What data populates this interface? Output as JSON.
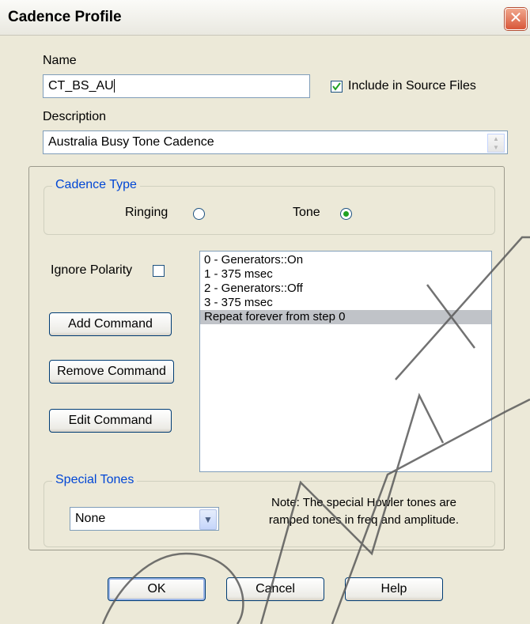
{
  "window": {
    "title": "Cadence Profile",
    "close_glyph": "✕"
  },
  "name": {
    "label": "Name",
    "value": "CT_BS_AU"
  },
  "include_source": {
    "label": "Include in Source Files",
    "checked": true
  },
  "description": {
    "label": "Description",
    "value": "Australia Busy Tone Cadence"
  },
  "cadence_type": {
    "title": "Cadence Type",
    "ringing_label": "Ringing",
    "tone_label": "Tone",
    "selected": "Tone"
  },
  "ignore_polarity": {
    "label": "Ignore Polarity",
    "checked": false
  },
  "buttons": {
    "add": "Add Command",
    "remove": "Remove Command",
    "edit": "Edit Command",
    "ok": "OK",
    "cancel": "Cancel",
    "help": "Help"
  },
  "commands": [
    "0 - Generators::On",
    "1 - 375 msec",
    "2 - Generators::Off",
    "3 - 375 msec",
    "Repeat forever from step 0"
  ],
  "selected_command_index": 4,
  "special_tones": {
    "title": "Special Tones",
    "value": "None",
    "note_line1": "Note: The special Howler tones are",
    "note_line2": "ramped tones in freq and amplitude."
  },
  "watermark": {
    "text": "DNET",
    "color": "#5a5a5a"
  }
}
